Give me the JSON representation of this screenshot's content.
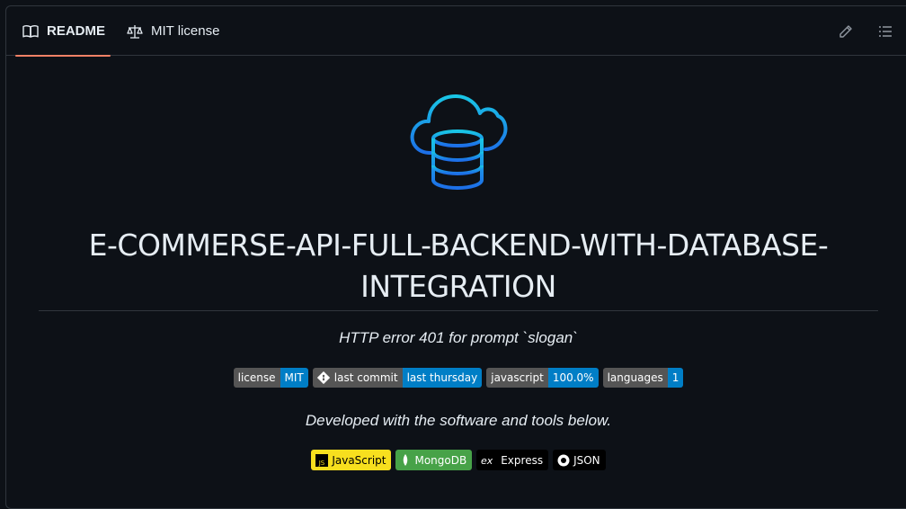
{
  "tabs": {
    "readme": "README",
    "license": "MIT license"
  },
  "title": "E-COMMERSE-API-FULL-BACKEND-WITH-DATABASE-INTEGRATION",
  "slogan": "HTTP error 401 for prompt `slogan`",
  "badges": [
    {
      "label": "license",
      "value": "MIT"
    },
    {
      "label": "last commit",
      "value": "last thursday"
    },
    {
      "label": "javascript",
      "value": "100.0%"
    },
    {
      "label": "languages",
      "value": "1"
    }
  ],
  "tools_heading": "Developed with the software and tools below.",
  "tools": [
    {
      "name": "JavaScript",
      "icon": "javascript-icon",
      "color": "#f7df1e"
    },
    {
      "name": "MongoDB",
      "icon": "mongodb-icon",
      "color": "#47a248"
    },
    {
      "name": "Express",
      "icon": "express-icon",
      "color": "#000000"
    },
    {
      "name": "JSON",
      "icon": "json-icon",
      "color": "#000000"
    }
  ],
  "colors": {
    "background": "#0d1117",
    "border": "#30363d",
    "tab_underline": "#f78166",
    "badge_label": "#555555",
    "badge_value": "#007ec6"
  }
}
